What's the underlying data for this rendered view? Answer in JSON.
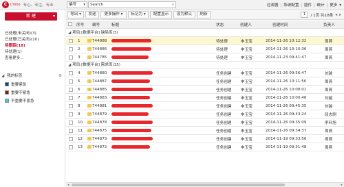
{
  "brand": {
    "mark": "C",
    "sub": "Cmho",
    "slogan": "专心、专注、专业"
  },
  "search": {
    "field": "编号",
    "value": "Search"
  },
  "top_links": [
    "过滤器",
    "系统配置",
    "插件",
    "统计",
    "更多"
  ],
  "left_nav": {
    "new_button": "新 建",
    "items": [
      "已处理(未关闭)(3)",
      "已处理(已关闭)(10)",
      "待跟踪(18)",
      "待处理(1)",
      "查看更多..."
    ],
    "active_index": 2,
    "tags_title": "我的标签",
    "tags": [
      {
        "label": "重要紧急",
        "color": "#1a3c9a"
      },
      {
        "label": "重要不紧急",
        "color": "#8b1a1a"
      },
      {
        "label": "不重要不紧急",
        "color": "#3fd0d6"
      }
    ]
  },
  "toolbar": {
    "buttons": [
      "导出",
      "发送",
      "更多操作",
      "标记为",
      "配置显示",
      "设为默认",
      "刷新"
    ],
    "page": "1",
    "page_info": "/ 1页 共18条"
  },
  "columns": [
    "序号",
    "编号",
    "标题",
    "状态",
    "创建人",
    "创建时间",
    "负责人"
  ],
  "groups": [
    {
      "label": "项目:[数据平台] 缺陷库(3)",
      "rows": [
        {
          "no": "1",
          "id": "744888",
          "status": "待处理",
          "creator": "申玉宝",
          "time": "2014-11-26 10:12:32",
          "owner": "周燕"
        },
        {
          "no": "2",
          "id": "744886",
          "status": "待处理",
          "creator": "申玉宝",
          "time": "2014-11-26 10:10:36",
          "owner": "周燕"
        },
        {
          "no": "3",
          "id": "744785",
          "status": "待处理",
          "creator": "申玉宝",
          "time": "2014-11-23 09:41:47",
          "owner": "周燕"
        }
      ]
    },
    {
      "label": "项目:[数据平台] 需求库(15)",
      "rows": [
        {
          "no": "4",
          "id": "744880",
          "status": "任务创建",
          "creator": "申玉宝",
          "time": "2014-11-26 09:56:47",
          "owner": "刘越"
        },
        {
          "no": "5",
          "id": "744887",
          "status": "任务创建",
          "creator": "申玉宝",
          "time": "2014-11-26 10:11:56",
          "owner": "周燕"
        },
        {
          "no": "6",
          "id": "744885",
          "status": "任务创建",
          "creator": "申玉宝",
          "time": "2014-11-26 10:08:01",
          "owner": "周燕"
        },
        {
          "no": "7",
          "id": "744883",
          "status": "任务创建",
          "creator": "申玉宝",
          "time": "2014-11-26 10:00:46",
          "owner": "刘越"
        },
        {
          "no": "8",
          "id": "744881",
          "status": "任务创建",
          "creator": "申玉宝",
          "time": "2014-11-26 09:45:35",
          "owner": "刘越"
        },
        {
          "no": "9",
          "id": "744879",
          "status": "任务创建",
          "creator": "申玉宝",
          "time": "2014-11-26 09:43:24",
          "owner": "段志刚"
        },
        {
          "no": "10",
          "id": "744878",
          "status": "任务创建",
          "creator": "申玉宝",
          "time": "2014-11-26 09:35:09",
          "owner": "李轩旭"
        },
        {
          "no": "11",
          "id": "744875",
          "status": "任务创建",
          "creator": "申玉宝",
          "time": "2014-11-26 09:34:37",
          "owner": "周燕"
        },
        {
          "no": "12",
          "id": "744873",
          "status": "任务创建",
          "creator": "申玉宝",
          "time": "2014-11-19 09:33:56",
          "owner": "周燕"
        },
        {
          "no": "13",
          "id": "744872",
          "status": "任务创建",
          "creator": "申玉宝",
          "time": "2014-11-19 09:31:48",
          "owner": "周燕"
        }
      ]
    }
  ]
}
